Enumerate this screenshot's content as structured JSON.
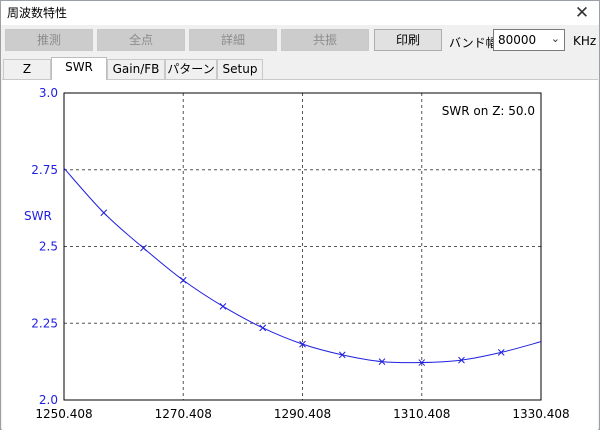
{
  "window": {
    "title": "周波数特性",
    "close_label": "✕"
  },
  "toolbar": {
    "buttons": [
      {
        "label": "推測",
        "enabled": false
      },
      {
        "label": "全点",
        "enabled": false
      },
      {
        "label": "詳細",
        "enabled": false
      },
      {
        "label": "共振",
        "enabled": false
      },
      {
        "label": "印刷",
        "enabled": true
      }
    ],
    "band_label": "バンド幅",
    "band_value": "80000",
    "band_unit": "KHz"
  },
  "tabs": [
    {
      "label": "Z",
      "active": false
    },
    {
      "label": "SWR",
      "active": true
    },
    {
      "label": "Gain/FB",
      "active": false
    },
    {
      "label": "パターン",
      "active": false
    },
    {
      "label": "Setup",
      "active": false
    }
  ],
  "chart_data": {
    "type": "line",
    "title": "",
    "annotation": "SWR on Z: 50.0",
    "xlabel": "",
    "ylabel": "SWR",
    "xlim": [
      1250.408,
      1330.408
    ],
    "ylim": [
      2.0,
      3.0
    ],
    "x_ticks": [
      "1250.408",
      "1270.408",
      "1290.408",
      "1310.408",
      "1330.408"
    ],
    "y_ticks": [
      "3.0",
      "2.75",
      "2.5",
      "2.25",
      "2.0"
    ],
    "grid": true,
    "line_color": "#2020e0",
    "series": [
      {
        "x": [
          1250.408,
          1257.08,
          1263.74,
          1270.41,
          1277.07,
          1283.74,
          1290.41,
          1297.08,
          1303.74,
          1310.41,
          1317.07,
          1323.74,
          1330.408
        ],
        "y": [
          2.755,
          2.61,
          2.495,
          2.39,
          2.305,
          2.235,
          2.182,
          2.147,
          2.125,
          2.122,
          2.13,
          2.155,
          2.19
        ]
      }
    ]
  }
}
